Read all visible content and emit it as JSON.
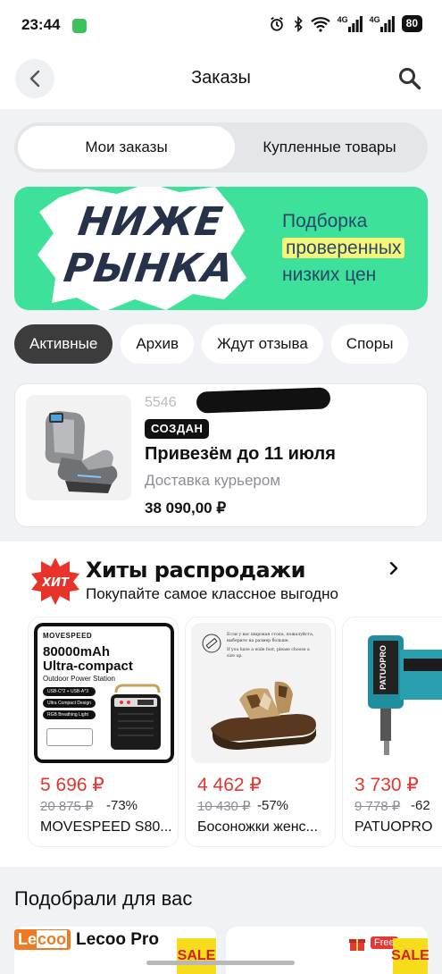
{
  "status_bar": {
    "time": "23:44",
    "network_1": "4G",
    "network_2": "4G",
    "battery": "80",
    "icons": [
      "chat-app-icon",
      "alarm-icon",
      "bluetooth-icon",
      "wifi-icon",
      "signal-icon",
      "signal-icon",
      "battery-icon"
    ]
  },
  "header": {
    "title": "Заказы",
    "back_icon": "chevron-left-icon",
    "search_icon": "search-icon"
  },
  "segmented": {
    "tabs": [
      {
        "label": "Мои заказы",
        "selected": true
      },
      {
        "label": "Купленные товары",
        "selected": false
      }
    ]
  },
  "banner": {
    "headline_1": "НИЖЕ",
    "headline_2": "РЫНКА",
    "line_1": "Подборка",
    "line_2": "проверенных",
    "line_3": "низких цен",
    "bg_color": "#3ee19a",
    "highlight_color": "#f5f57a"
  },
  "filters": {
    "chips": [
      {
        "label": "Активные",
        "selected": true
      },
      {
        "label": "Архив",
        "selected": false
      },
      {
        "label": "Ждут отзыва",
        "selected": false
      },
      {
        "label": "Споры",
        "selected": false
      }
    ]
  },
  "order": {
    "number_partial": "5546",
    "status": "СОЗДАН",
    "delivery_date": "Привезём до 11 июля",
    "delivery_method": "Доставка курьером",
    "price": "38 090,00 ₽",
    "image": "massage-chair"
  },
  "hits": {
    "badge": "ХИТ",
    "title": "Хиты распродажи",
    "subtitle": "Покупайте самое классное выгодно",
    "more_icon": "chevron-right-icon",
    "products": [
      {
        "price": "5 696 ₽",
        "old_price": "20 875 ₽",
        "discount": "-73%",
        "name": "MOVESPEED S80...",
        "image": "power-station",
        "img_brand": "MOVESPEED",
        "img_line_1": "80000mAh",
        "img_line_2": "Ultra-compact",
        "img_line_3": "Outdoor Power Station",
        "img_features": [
          "USB-C*2 + USB-A*3",
          "Ultra Compact Design",
          "RGB Breathing Light"
        ]
      },
      {
        "price": "4 462 ₽",
        "old_price": "10 430 ₽",
        "discount": "-57%",
        "name": "Босоножки женс...",
        "image": "sandal",
        "img_note_ru_1": "Если у вас широкая стопа, пожалуйста,",
        "img_note_ru_2": "выберите на размер больше.",
        "img_note_en_1": "If you have a wide foot, please choose a",
        "img_note_en_2": "size up."
      },
      {
        "price": "3 730 ₽",
        "old_price": "9 778 ₽",
        "discount": "-62",
        "name": "PATUOPRO",
        "image": "nail-gun",
        "img_brand": "PATUOPRO"
      }
    ]
  },
  "recommendations": {
    "title": "Подобрали для вас",
    "brand_mark": "Le",
    "brand_mark_2": "coo",
    "brand_name": "Lecoo Pro",
    "sale_label": "SALE",
    "free_label": "Free"
  },
  "colors": {
    "accent_price": "#e1362f",
    "chip_active": "#3c3c3c",
    "background": "#f1f2f5"
  }
}
